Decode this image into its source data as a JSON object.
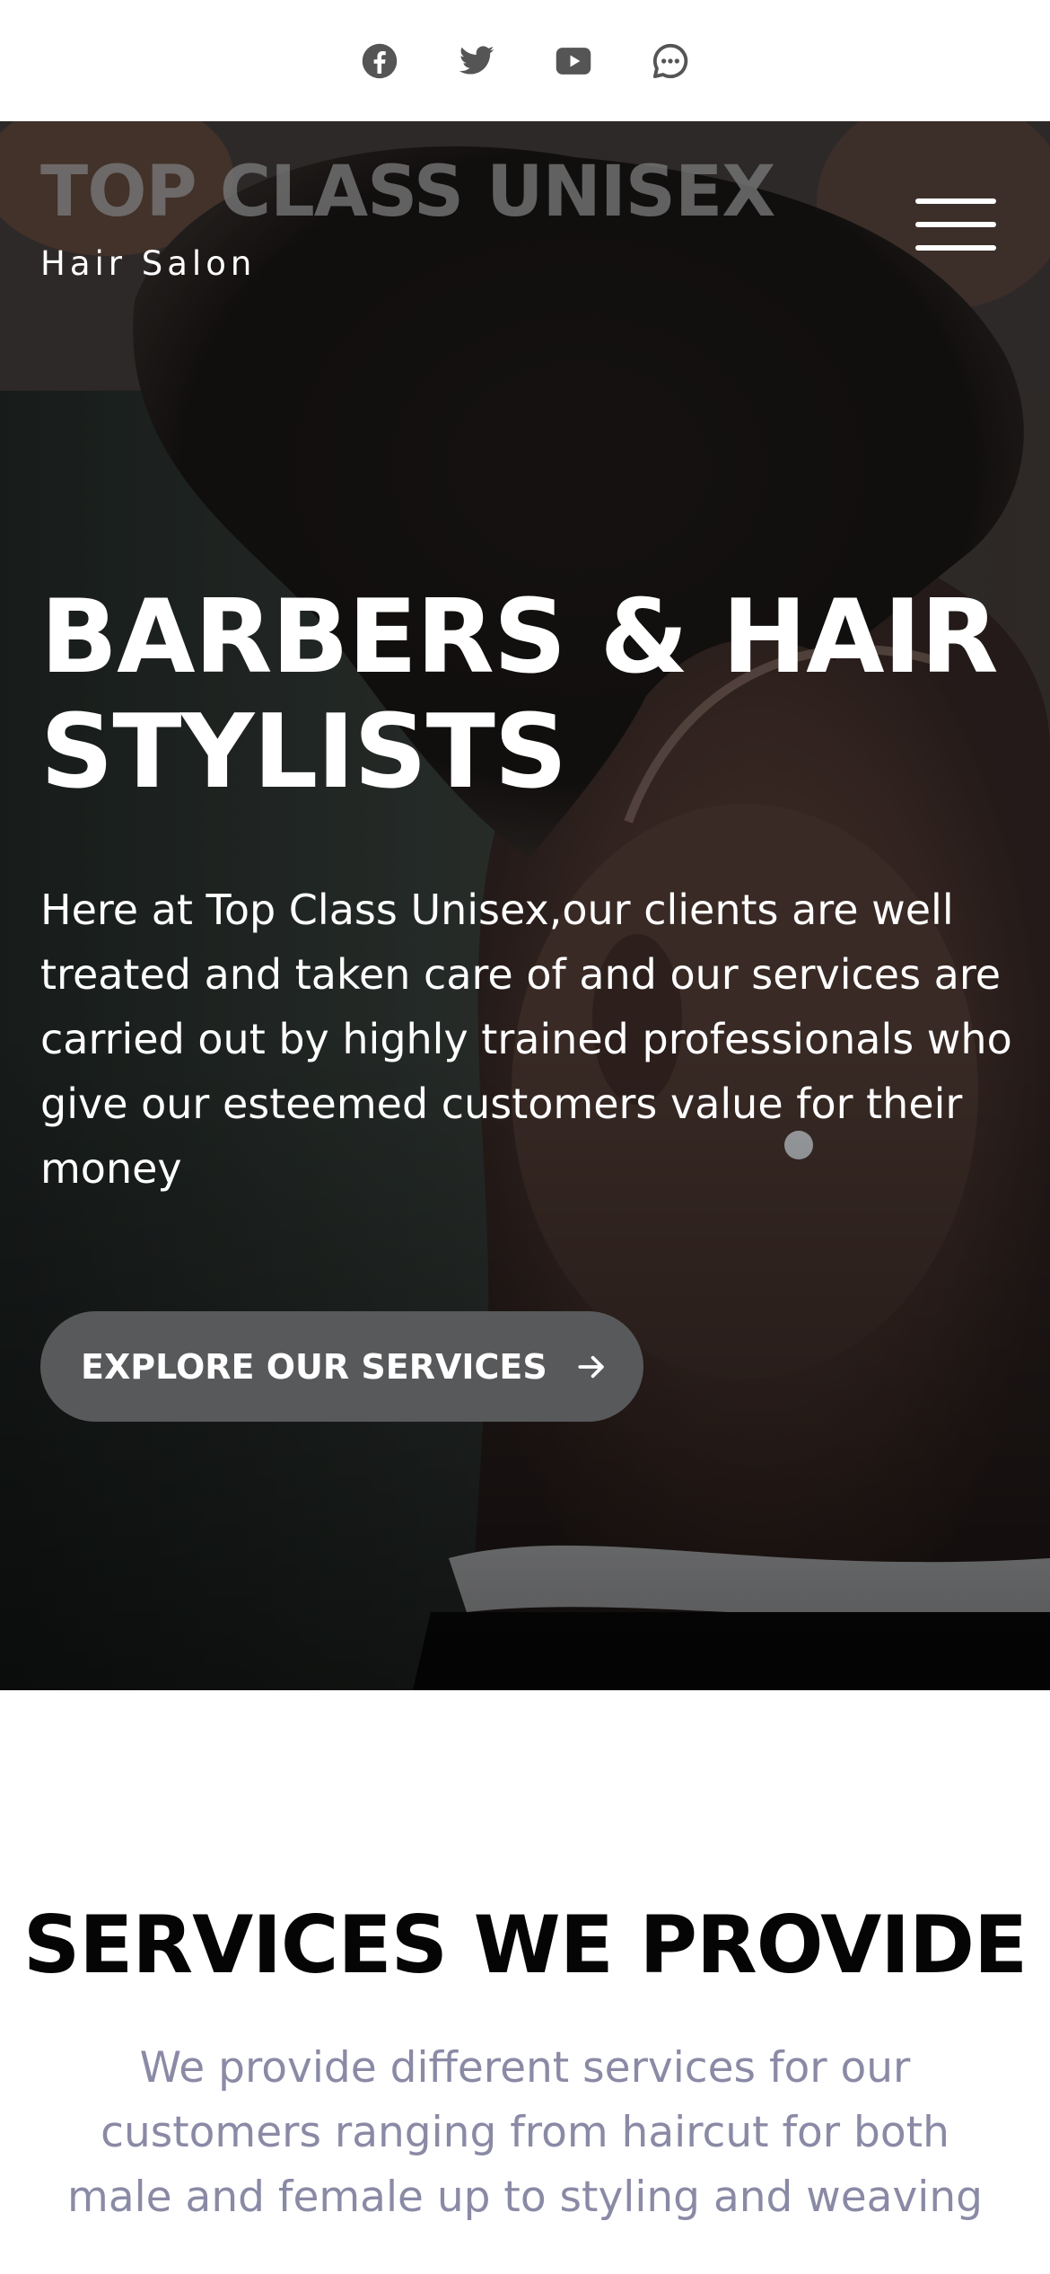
{
  "social": {
    "icons": [
      "facebook-icon",
      "twitter-icon",
      "youtube-icon",
      "chat-icon"
    ],
    "color": "#555555"
  },
  "header": {
    "brand_name": "TOP CLASS UNISEX",
    "tagline": "Hair Salon",
    "menu_icon": "hamburger-menu-icon"
  },
  "hero": {
    "title_line1": "BARBERS & HAIR",
    "title_line2": "STYLISTS",
    "description": "Here at Top Class Unisex,our clients are well treated and taken care of and our services are carried out by highly trained professionals who give our esteemed customers value for their money",
    "cta_label": "EXPLORE OUR SERVICES",
    "cta_icon": "arrow-right-icon",
    "cta_color": "#58595b"
  },
  "services": {
    "title": "SERVICES WE PROVIDE",
    "description": "We provide different services for our customers ranging from haircut for both male and female up to styling and weaving",
    "description_color": "#8a8aa6"
  }
}
